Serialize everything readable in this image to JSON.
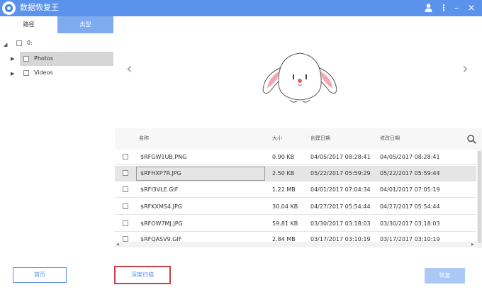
{
  "window": {
    "title": "数据恢复王"
  },
  "sidebar": {
    "tabs": [
      {
        "label": "路径"
      },
      {
        "label": "类型"
      }
    ],
    "tree": [
      {
        "label": "0:"
      },
      {
        "label": "Photos"
      },
      {
        "label": "Videos"
      }
    ]
  },
  "preview": {
    "prev_icon": "‹",
    "next_icon": "›"
  },
  "table": {
    "headers": {
      "name": "名称",
      "size": "大小",
      "created": "创建日期",
      "modified": "修改日期"
    },
    "rows": [
      {
        "name": "$RFGW1UB.PNG",
        "size": "0.90 KB",
        "created": "04/05/2017 08:28:41",
        "modified": "04/05/2017 08:28:41"
      },
      {
        "name": "$RFHXP7R.JPG",
        "size": "2.50 KB",
        "created": "05/22/2017 05:59:29",
        "modified": "05/22/2017 05:59:44"
      },
      {
        "name": "$RFI3VLE.GIF",
        "size": "1.22 MB",
        "created": "04/01/2017 07:04:34",
        "modified": "04/01/2017 07:05:19"
      },
      {
        "name": "$RFKXMS4.JPG",
        "size": "30.04 KB",
        "created": "04/27/2017 05:54:44",
        "modified": "04/27/2017 05:54:44"
      },
      {
        "name": "$RFOW7MJ.JPG",
        "size": "59.81 KB",
        "created": "03/30/2017 03:18:03",
        "modified": "03/30/2017 03:18:03"
      },
      {
        "name": "$RFQASV9.GIF",
        "size": "2.84 MB",
        "created": "03/17/2017 03:10:19",
        "modified": "03/17/2017 03:10:19"
      }
    ]
  },
  "footer": {
    "home_label": "首页",
    "deep_scan_label": "深度扫描",
    "recover_label": "恢复"
  },
  "colors": {
    "accent": "#5b93ec",
    "tab_active": "#7eaaf0",
    "highlight_border": "#c9404a",
    "recover_disabled": "#a9c8f5"
  },
  "icons": [
    "app-logo-icon",
    "user-icon",
    "menu-icon",
    "minimize-icon",
    "close-icon",
    "search-icon",
    "rabbit-illustration"
  ]
}
